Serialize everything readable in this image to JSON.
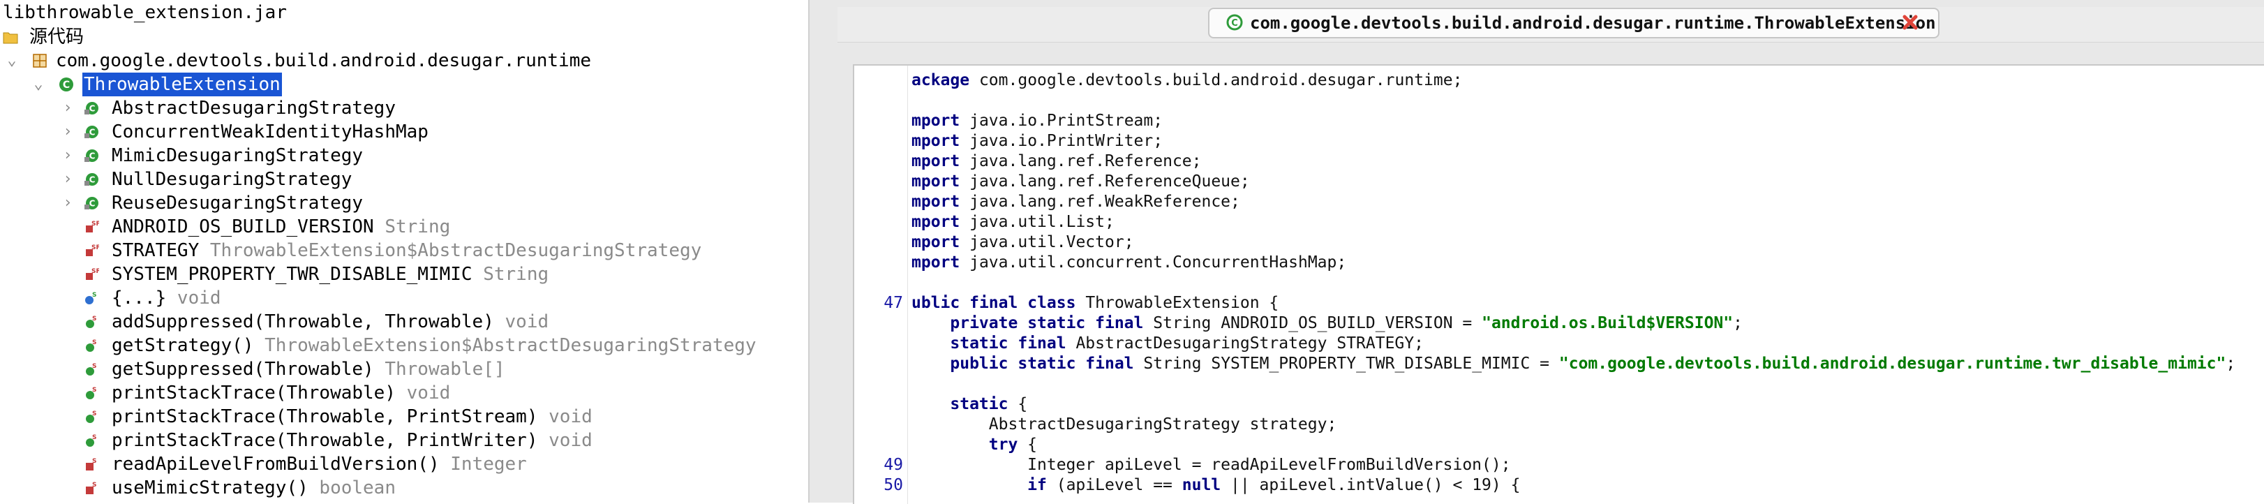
{
  "tree": {
    "jar": "libthrowable_extension.jar",
    "source_folder": "源代码",
    "package": "com.google.devtools.build.android.desugar.runtime",
    "selected_class": "ThrowableExtension",
    "nested_classes": [
      "AbstractDesugaringStrategy",
      "ConcurrentWeakIdentityHashMap",
      "MimicDesugaringStrategy",
      "NullDesugaringStrategy",
      "ReuseDesugaringStrategy"
    ],
    "members": [
      {
        "name": "ANDROID_OS_BUILD_VERSION",
        "type": "String",
        "icon": "static-final-field-icon"
      },
      {
        "name": "STRATEGY",
        "type": "ThrowableExtension$AbstractDesugaringStrategy",
        "icon": "static-final-field-icon"
      },
      {
        "name": "SYSTEM_PROPERTY_TWR_DISABLE_MIMIC",
        "type": "String",
        "icon": "static-final-field-icon"
      },
      {
        "name": "{...}",
        "type": "void",
        "icon": "static-initializer-icon"
      },
      {
        "name": "addSuppressed(Throwable, Throwable)",
        "type": "void",
        "icon": "static-method-icon"
      },
      {
        "name": "getStrategy()",
        "type": "ThrowableExtension$AbstractDesugaringStrategy",
        "icon": "static-method-icon"
      },
      {
        "name": "getSuppressed(Throwable)",
        "type": "Throwable[]",
        "icon": "static-method-icon"
      },
      {
        "name": "printStackTrace(Throwable)",
        "type": "void",
        "icon": "static-method-icon"
      },
      {
        "name": "printStackTrace(Throwable, PrintStream)",
        "type": "void",
        "icon": "static-method-icon"
      },
      {
        "name": "printStackTrace(Throwable, PrintWriter)",
        "type": "void",
        "icon": "static-method-icon"
      },
      {
        "name": "readApiLevelFromBuildVersion()",
        "type": "Integer",
        "icon": "private-static-method-icon"
      },
      {
        "name": "useMimicStrategy()",
        "type": "boolean",
        "icon": "private-static-method-icon"
      }
    ]
  },
  "editor": {
    "tab_title": "com.google.devtools.build.android.desugar.runtime.ThrowableExtension",
    "lines": [
      {
        "ln": "",
        "code": "ackage com.google.devtools.build.android.desugar.runtime;"
      },
      {
        "ln": "",
        "code": ""
      },
      {
        "ln": "",
        "code": "mport java.io.PrintStream;"
      },
      {
        "ln": "",
        "code": "mport java.io.PrintWriter;"
      },
      {
        "ln": "",
        "code": "mport java.lang.ref.Reference;"
      },
      {
        "ln": "",
        "code": "mport java.lang.ref.ReferenceQueue;"
      },
      {
        "ln": "",
        "code": "mport java.lang.ref.WeakReference;"
      },
      {
        "ln": "",
        "code": "mport java.util.List;"
      },
      {
        "ln": "",
        "code": "mport java.util.Vector;"
      },
      {
        "ln": "",
        "code": "mport java.util.concurrent.ConcurrentHashMap;"
      },
      {
        "ln": "",
        "code": ""
      },
      {
        "ln": "47",
        "code": "ublic final class ThrowableExtension {"
      },
      {
        "ln": "",
        "code": "    private static final String ANDROID_OS_BUILD_VERSION = \"android.os.Build$VERSION\";"
      },
      {
        "ln": "",
        "code": "    static final AbstractDesugaringStrategy STRATEGY;"
      },
      {
        "ln": "",
        "code": "    public static final String SYSTEM_PROPERTY_TWR_DISABLE_MIMIC = \"com.google.devtools.build.android.desugar.runtime.twr_disable_mimic\";"
      },
      {
        "ln": "",
        "code": ""
      },
      {
        "ln": "",
        "code": "    static {"
      },
      {
        "ln": "",
        "code": "        AbstractDesugaringStrategy strategy;"
      },
      {
        "ln": "",
        "code": "        try {"
      },
      {
        "ln": "49",
        "code": "            Integer apiLevel = readApiLevelFromBuildVersion();"
      },
      {
        "ln": "50",
        "code": "            if (apiLevel == null || apiLevel.intValue() < 19) {"
      }
    ]
  },
  "colors": {
    "selection": "#1a55d4",
    "keyword": "#000080",
    "string": "#007a00",
    "line_number": "#1a1aa6",
    "class_icon": "#2e9b3a"
  }
}
